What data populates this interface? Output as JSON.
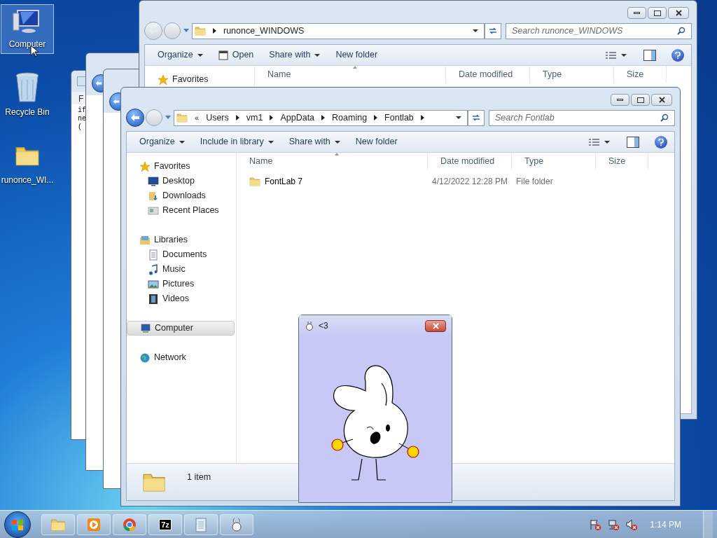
{
  "desktop_icons": [
    {
      "label": "Computer",
      "kind": "computer",
      "selected": true
    },
    {
      "label": "Recycle Bin",
      "kind": "recycle",
      "selected": false
    },
    {
      "label": "runonce_WI...",
      "kind": "folder",
      "selected": false
    }
  ],
  "notepad": {
    "menu": "F",
    "lines": [
      "if",
      "ne",
      "("
    ]
  },
  "back_explorer": {
    "address": [
      "runonce_WINDOWS"
    ],
    "search": {
      "placeholder": "Search runonce_WINDOWS"
    },
    "toolbar": [
      {
        "label": "Organize",
        "dropdown": true,
        "kind": "plain"
      },
      {
        "label": "Open",
        "dropdown": false,
        "kind": "open"
      },
      {
        "label": "Share with",
        "dropdown": true,
        "kind": "plain"
      },
      {
        "label": "New folder",
        "dropdown": false,
        "kind": "plain"
      }
    ],
    "nav": [
      {
        "label": "Favorites",
        "kind": "star",
        "selected": false
      }
    ],
    "columns": [
      "Name",
      "Date modified",
      "Type",
      "Size"
    ]
  },
  "front_explorer": {
    "overflow": "«",
    "address": [
      "Users",
      "vm1",
      "AppData",
      "Roaming",
      "Fontlab"
    ],
    "search": {
      "placeholder": "Search Fontlab"
    },
    "toolbar": [
      {
        "label": "Organize",
        "dropdown": true,
        "kind": "plain"
      },
      {
        "label": "Include in library",
        "dropdown": true,
        "kind": "plain"
      },
      {
        "label": "Share with",
        "dropdown": true,
        "kind": "plain"
      },
      {
        "label": "New folder",
        "dropdown": false,
        "kind": "plain"
      }
    ],
    "nav": [
      {
        "label": "Favorites",
        "kind": "star",
        "selected": false,
        "children": [
          {
            "label": "Desktop",
            "kind": "desktop",
            "selected": false
          },
          {
            "label": "Downloads",
            "kind": "downloads",
            "selected": false
          },
          {
            "label": "Recent Places",
            "kind": "recent",
            "selected": false
          }
        ]
      },
      {
        "label": "Libraries",
        "kind": "library",
        "selected": false,
        "children": [
          {
            "label": "Documents",
            "kind": "documents",
            "selected": false
          },
          {
            "label": "Music",
            "kind": "music",
            "selected": false
          },
          {
            "label": "Pictures",
            "kind": "pictures",
            "selected": false
          },
          {
            "label": "Videos",
            "kind": "videos",
            "selected": false
          }
        ]
      },
      {
        "label": "Computer",
        "kind": "computer",
        "selected": true
      },
      {
        "label": "Network",
        "kind": "network",
        "selected": false
      }
    ],
    "columns": [
      "Name",
      "Date modified",
      "Type",
      "Size"
    ],
    "rows": [
      {
        "name": "FontLab 7",
        "date": "4/12/2022 12:28 PM",
        "type": "File folder"
      }
    ],
    "status": "1 item"
  },
  "popup": {
    "title": "<3"
  },
  "taskbar": {
    "apps": [
      {
        "kind": "explorer"
      },
      {
        "kind": "media"
      },
      {
        "kind": "chrome"
      },
      {
        "kind": "archiver",
        "label": "7z"
      },
      {
        "kind": "notepad"
      },
      {
        "kind": "bunny"
      }
    ],
    "tray": [
      {
        "kind": "flag"
      },
      {
        "kind": "network"
      },
      {
        "kind": "volume"
      }
    ],
    "clock": "1:14 PM"
  }
}
